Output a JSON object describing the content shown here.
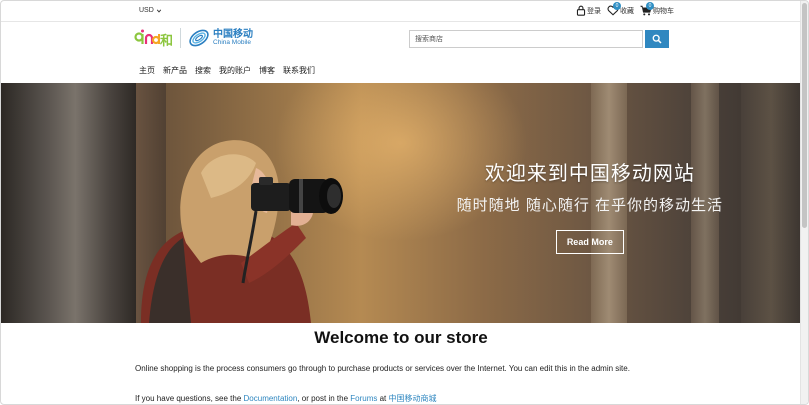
{
  "topbar": {
    "currency": "USD",
    "login": "登录",
    "favorites": "收藏",
    "favorites_count": "0",
    "cart": "购物车",
    "cart_count": "0"
  },
  "logo": {
    "he_text": "和",
    "cm_cn": "中国移动",
    "cm_en": "China Mobile"
  },
  "search": {
    "placeholder": "搜索商店"
  },
  "nav": {
    "items": [
      "主页",
      "新产品",
      "搜索",
      "我的账户",
      "博客",
      "联系我们"
    ]
  },
  "hero": {
    "title": "欢迎来到中国移动网站",
    "subtitle": "随时随地 随心随行 在乎你的移动生活",
    "button": "Read More"
  },
  "content": {
    "welcome": "Welcome to our store",
    "p1": "Online shopping is the process consumers go through to purchase products or services over the Internet. You can edit this in the admin site.",
    "p2_prefix": "If you have questions, see the ",
    "p2_link1": "Documentation",
    "p2_mid": ", or post in the ",
    "p2_link2": "Forums",
    "p2_at": " at ",
    "p2_link3": "中国移动商城"
  },
  "colors": {
    "accent": "#2f87c0",
    "badge": "#2f8fc4"
  }
}
